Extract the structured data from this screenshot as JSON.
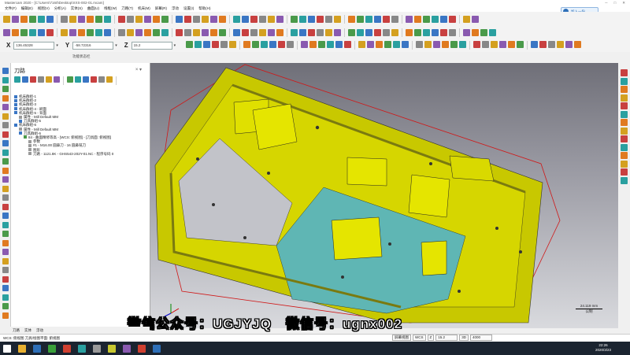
{
  "window": {
    "title": "Mastercam 2020 - [C:\\Users\\7160\\Desktop\\XXS-002-01.mcam]"
  },
  "menu": [
    "文件(F)",
    "编辑(E)",
    "视图(V)",
    "分析(A)",
    "实体(S)",
    "曲面(U)",
    "线框(W)",
    "刀路(T)",
    "机床(M)",
    "屏幕(R)",
    "浮动",
    "设置(I)",
    "帮助(H)"
  ],
  "cloud_button": {
    "label": "加入一份"
  },
  "coords": [
    {
      "axis": "X",
      "value": "136.45328"
    },
    {
      "axis": "Y",
      "value": "-58.72316"
    },
    {
      "axis": "Z",
      "value": "15.2"
    }
  ],
  "status_label": "功能状态栏",
  "panel": {
    "title": "刀路",
    "close": "× ▾",
    "tree": [
      {
        "indent": 0,
        "icon": "folder",
        "label": "机床群组-1"
      },
      {
        "indent": 0,
        "icon": "folder",
        "label": "机床群组-2"
      },
      {
        "indent": 0,
        "icon": "folder",
        "label": "机床群组-3"
      },
      {
        "indent": 0,
        "icon": "folder",
        "label": "机床群组-4 - 刷面"
      },
      {
        "indent": 0,
        "icon": "folder",
        "label": "机床群组-5 - 背面"
      },
      {
        "indent": 1,
        "icon": "doc",
        "label": "属性 - Mill Default MM"
      },
      {
        "indent": 1,
        "icon": "folder",
        "label": "刀具群组-5"
      },
      {
        "indent": 0,
        "icon": "folder",
        "label": "机床群组-6"
      },
      {
        "indent": 1,
        "icon": "doc",
        "label": "属性 - Mill Default MM"
      },
      {
        "indent": 1,
        "icon": "folder",
        "label": "刀具群组-6"
      },
      {
        "indent": 2,
        "icon": "op",
        "label": "84 - 曲面精修等高 - [WCS: 俯视图] - [刀具面: 俯视图]"
      },
      {
        "indent": 3,
        "icon": "doc",
        "label": "参数"
      },
      {
        "indent": 3,
        "icon": "doc",
        "label": "#1 - M16.00 圆鼻刀 - 16 圆鼻铣刀"
      },
      {
        "indent": 3,
        "icon": "doc",
        "label": "图形"
      },
      {
        "indent": 3,
        "icon": "doc",
        "label": "刀路 - 1121.8K - GHS543-202Y-01.NC - 程序号码 0"
      }
    ]
  },
  "viewport": {
    "scale_value": "24.119 mm",
    "scale_unit": "公制",
    "axis_labels": [
      "X",
      "Y",
      "Z"
    ],
    "view_label": "工作坐标系"
  },
  "watermark": "微信公众号：UGJYJQ　微信号：ugnx002",
  "bottom_tabs": [
    "刀路",
    "实体",
    "浮动"
  ],
  "statusbar": {
    "left": "WCS: 俯视图   刀具/绘图平面: 俯视图",
    "cells": [
      "屏幕视图",
      "WCS",
      "Z",
      "15.2",
      "3D",
      "4000"
    ]
  },
  "clock": {
    "time": "22:26",
    "date": "2020/3/23"
  },
  "colors": {
    "part_yellow": "#d6d600",
    "part_teal": "#5fb6b4",
    "boundary_red": "#d01818",
    "viewport_top": "#6f6f78",
    "viewport_bottom": "#d9dade"
  }
}
